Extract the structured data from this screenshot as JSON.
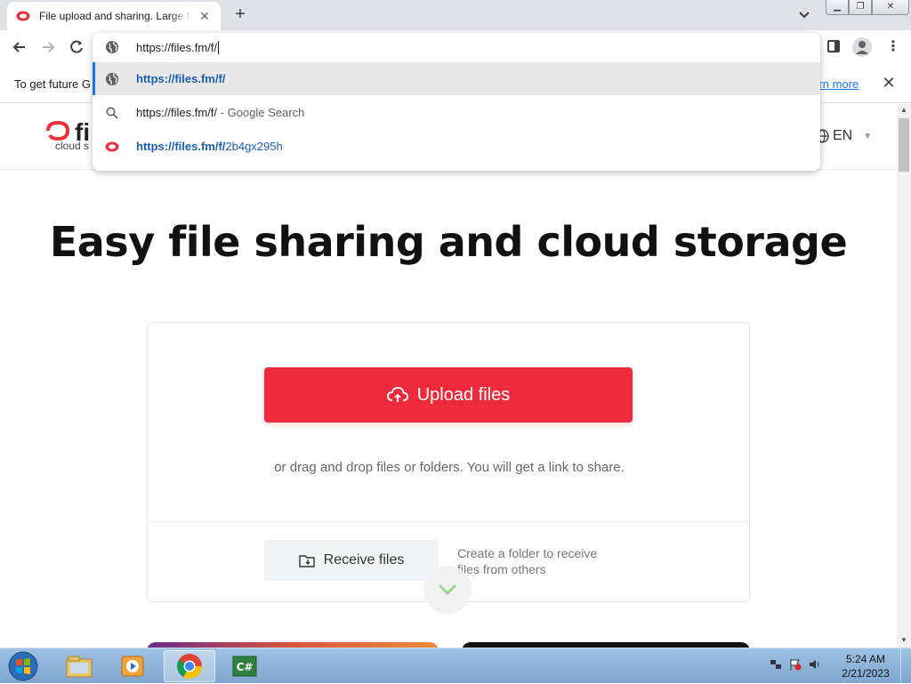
{
  "browser": {
    "tab_title": "File upload and sharing. Large fil",
    "tab_close": "✕",
    "new_tab": "+",
    "address_value": "https://files.fm/f/",
    "suggestions": [
      {
        "icon": "globe-icon",
        "bold": "https://files.fm/f/",
        "rest": ""
      },
      {
        "icon": "search-icon",
        "plain": "https://files.fm/f/",
        "rest": " - Google Search"
      },
      {
        "icon": "files-fm-favicon",
        "bold": "https://files.fm/f/",
        "rest": "2b4gx295h"
      }
    ],
    "menu_glyph": "⋮"
  },
  "infobar": {
    "text": "To get future G",
    "link": "earn more",
    "close": "✕"
  },
  "site": {
    "logo_word": "fi",
    "logo_sub": "cloud s",
    "language": "EN",
    "hero_title": "Easy file sharing and cloud storage",
    "upload_label": "Upload files",
    "drag_text": "or drag and drop files or folders. You will get a link to share.",
    "receive_label": "Receive files",
    "receive_desc": "Create a folder to receive files from others"
  },
  "taskbar": {
    "time": "5:24 AM",
    "date": "2/21/2023"
  },
  "colors": {
    "brand_red": "#ee2a3c",
    "link_blue": "#1a73e8"
  }
}
